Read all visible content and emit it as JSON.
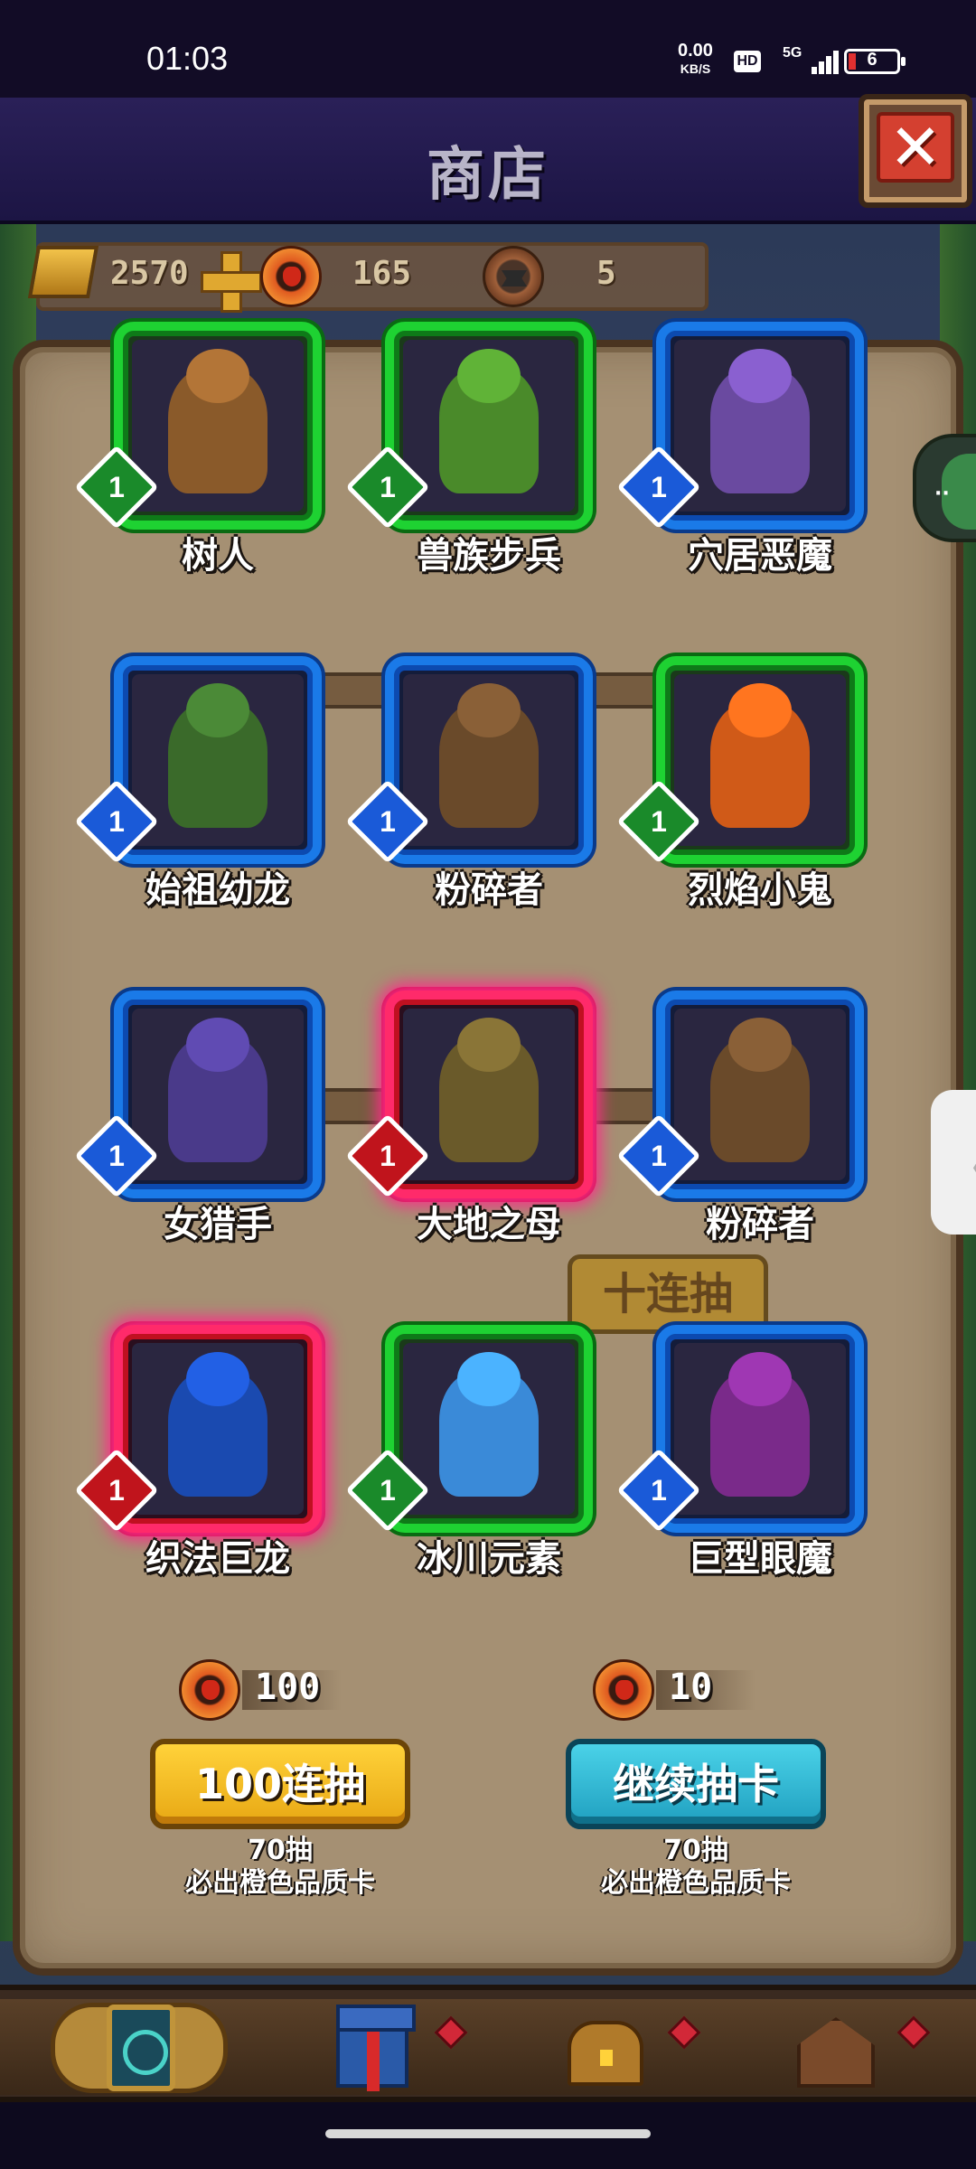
{
  "status_bar": {
    "time": "01:03",
    "net_speed_value": "0.00",
    "net_speed_unit": "KB/S",
    "hd": "HD",
    "signal": "5G",
    "battery": "6"
  },
  "header": {
    "title": "商店",
    "close_label": "✕"
  },
  "currency": {
    "gold": "2570",
    "tokens": "165",
    "anvil": "5"
  },
  "cards": [
    {
      "name": "树人",
      "level": "1",
      "rarity": "green",
      "color": "#8a5a2a"
    },
    {
      "name": "兽族步兵",
      "level": "1",
      "rarity": "green",
      "color": "#4a8a2a"
    },
    {
      "name": "穴居恶魔",
      "level": "1",
      "rarity": "blue",
      "color": "#6a4aa0"
    },
    {
      "name": "始祖幼龙",
      "level": "1",
      "rarity": "blue",
      "color": "#3a6a2a"
    },
    {
      "name": "粉碎者",
      "level": "1",
      "rarity": "blue",
      "color": "#6a4a2a"
    },
    {
      "name": "烈焰小鬼",
      "level": "1",
      "rarity": "green",
      "color": "#d05a18"
    },
    {
      "name": "女猎手",
      "level": "1",
      "rarity": "blue",
      "color": "#4a3a8a"
    },
    {
      "name": "大地之母",
      "level": "1",
      "rarity": "red",
      "color": "#6a5a2a"
    },
    {
      "name": "粉碎者",
      "level": "1",
      "rarity": "blue",
      "color": "#6a4a2a"
    },
    {
      "name": "织法巨龙",
      "level": "1",
      "rarity": "red",
      "color": "#1a4ab0"
    },
    {
      "name": "冰川元素",
      "level": "1",
      "rarity": "green",
      "color": "#3a8ad8"
    },
    {
      "name": "巨型眼魔",
      "level": "1",
      "rarity": "blue",
      "color": "#7a2a8a"
    }
  ],
  "background": {
    "ghost_button": "十连抽"
  },
  "draw": {
    "left": {
      "price": "100",
      "button": "100连抽",
      "note_line1": "70抽",
      "note_line2": "必出橙色品质卡"
    },
    "right": {
      "price": "10",
      "button": "继续抽卡",
      "note_line1": "70抽",
      "note_line2": "必出橙色品质卡"
    }
  },
  "nav": {
    "items": [
      "card-deck-icon",
      "gift-icon",
      "treasure-chest-icon",
      "hut-icon"
    ]
  },
  "side": {
    "dots": "··",
    "chevron": "〈"
  }
}
